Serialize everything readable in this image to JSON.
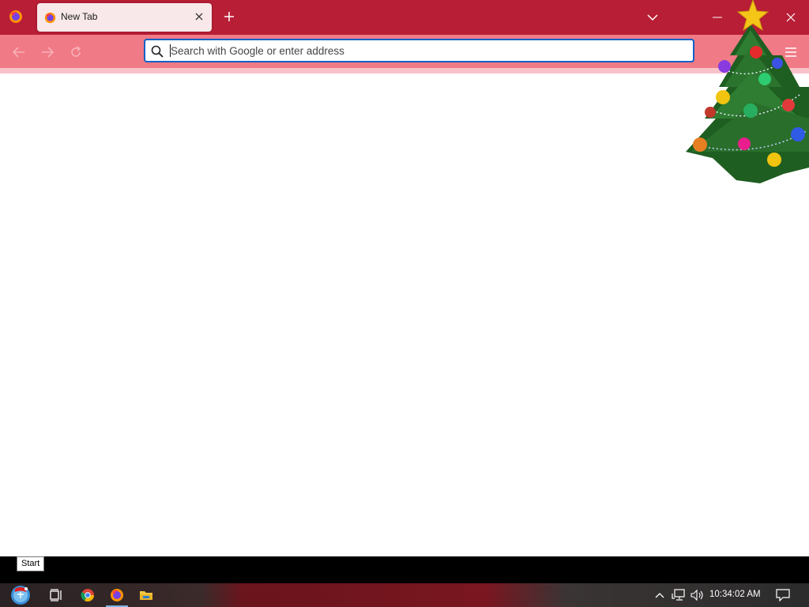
{
  "browser": {
    "tab": {
      "title": "New Tab",
      "favicon": "firefox-icon",
      "close_icon": "close-icon"
    },
    "titlebar_icons": [
      "firefox-menu-icon",
      "plus-icon",
      "chevron-down-icon",
      "minimize-icon",
      "close-icon"
    ],
    "nav": {
      "back_icon": "arrow-left-icon",
      "forward_icon": "arrow-right-icon",
      "reload_icon": "reload-icon",
      "menu_icon": "hamburger-menu-icon"
    },
    "urlbar": {
      "placeholder": "Search with Google or enter address",
      "value": "",
      "icon": "search-icon"
    }
  },
  "decoration": {
    "name": "christmas-tree"
  },
  "taskbar": {
    "tooltip": "Start",
    "items": [
      "start-icon",
      "task-view-icon",
      "chrome-icon",
      "firefox-icon",
      "file-explorer-icon"
    ],
    "active_item": "firefox-icon",
    "tray_icons": [
      "chevron-up-icon",
      "network-icon",
      "volume-icon"
    ],
    "clock": "10:34:02 AM",
    "notification_icon": "notification-icon"
  },
  "colors": {
    "titlebar": "#b81e35",
    "toolbar": "#f07a86",
    "urlbar_focus": "#0a60c8"
  }
}
